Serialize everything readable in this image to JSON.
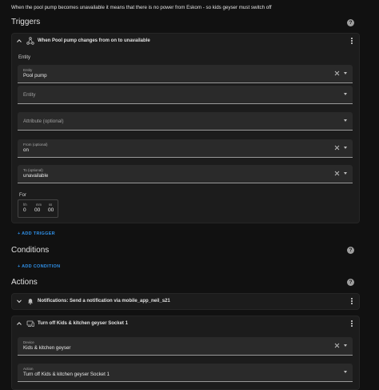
{
  "description": "When the pool pump becomes unavailable it means that there is no power from Eskom - so kids geyser must switch off",
  "triggers": {
    "title": "Triggers",
    "help": "?",
    "card": {
      "title": "When Pool pump changes from on to unavailable",
      "entity_heading": "Entity",
      "entity_field": {
        "label": "Entity",
        "value": "Pool pump"
      },
      "entity_empty_placeholder": "Entity",
      "attribute_placeholder": "Attribute (optional)",
      "from_field": {
        "label": "From (optional)",
        "value": "on"
      },
      "to_field": {
        "label": "To (optional)",
        "value": "unavailable"
      },
      "for": {
        "label": "For",
        "units": [
          "hh",
          "mm",
          "ss"
        ],
        "values": [
          "0",
          "00",
          "00"
        ]
      }
    },
    "add_label": "ADD TRIGGER"
  },
  "conditions": {
    "title": "Conditions",
    "help": "?",
    "add_label": "ADD CONDITION"
  },
  "actions": {
    "title": "Actions",
    "help": "?",
    "items": [
      {
        "title": "Notifications: Send a notification via mobile_app_neil_s21",
        "icon": "bell-icon"
      },
      {
        "title": "Turn off Kids & kitchen geyser Socket 1",
        "icon": "device-icon"
      }
    ],
    "device_field": {
      "label": "Device",
      "value": "Kids & kitchen geyser"
    },
    "action_field": {
      "label": "Action",
      "value": "Turn off Kids & kitchen geyser Socket 1"
    }
  }
}
